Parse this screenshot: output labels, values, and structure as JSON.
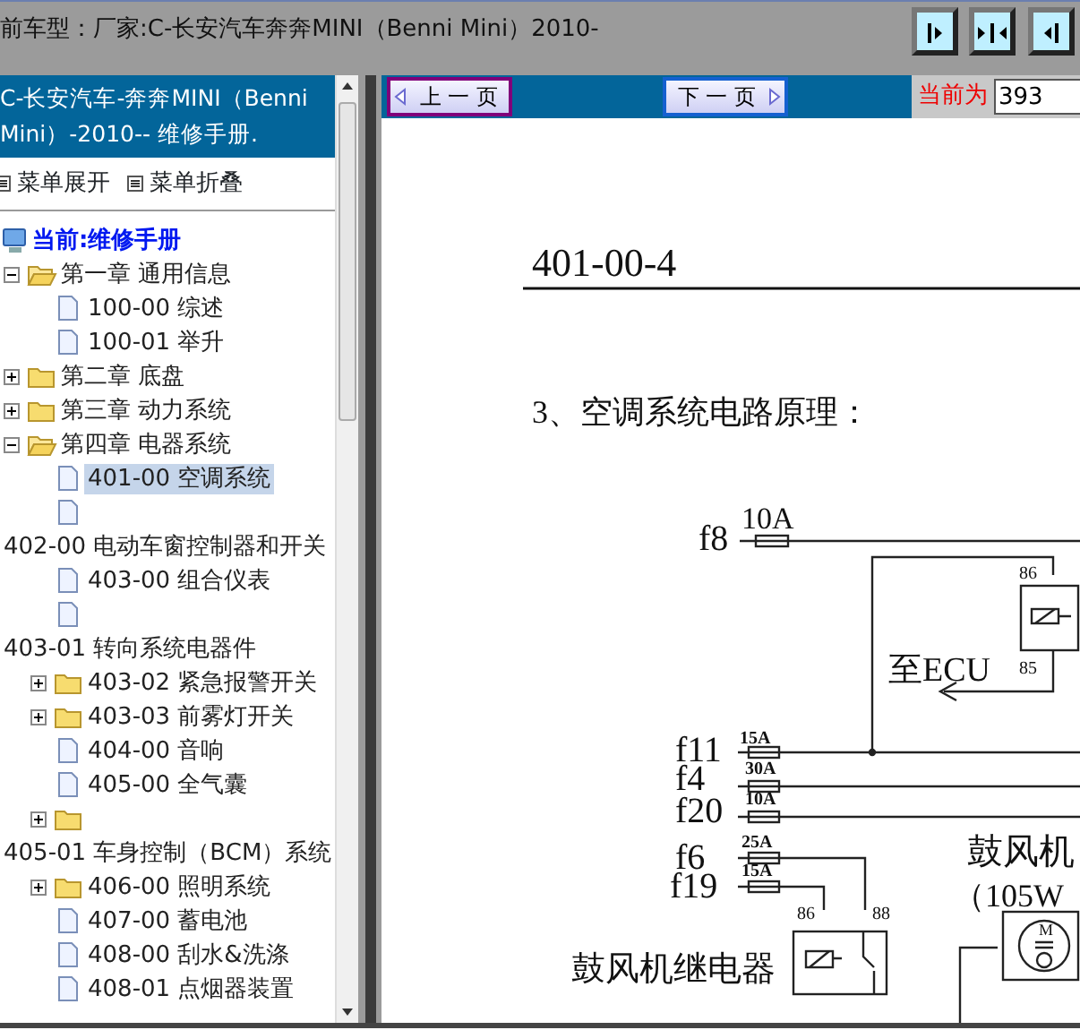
{
  "header": {
    "title": "前车型：厂家:C-长安汽车奔奔MINI（Benni Mini）2010-"
  },
  "sidebar": {
    "title": "C-长安汽车-奔奔MINI（Benni Mini）-2010-- 维修手册.",
    "menu_actions": [
      "菜单展开",
      "菜单折叠"
    ],
    "tree": [
      {
        "kind": "root",
        "label": "当前:维修手册",
        "selected": false,
        "children": [
          {
            "kind": "folder",
            "label": "第一章 通用信息",
            "expanded": true,
            "selected": false,
            "children": [
              {
                "kind": "doc",
                "label": "100-00 综述",
                "selected": false
              },
              {
                "kind": "doc",
                "label": "100-01 举升",
                "selected": false
              }
            ]
          },
          {
            "kind": "folder",
            "label": "第二章 底盘",
            "expanded": false,
            "selected": false
          },
          {
            "kind": "folder",
            "label": "第三章 动力系统",
            "expanded": false,
            "selected": false
          },
          {
            "kind": "folder",
            "label": "第四章 电器系统",
            "expanded": true,
            "selected": false,
            "children": [
              {
                "kind": "doc",
                "label": "401-00 空调系统",
                "selected": true
              },
              {
                "kind": "doc",
                "selected": false
              },
              {
                "kind": "plain",
                "label": "402-00 电动车窗控制器和开关",
                "selected": false
              },
              {
                "kind": "doc",
                "label": "403-00 组合仪表",
                "selected": false
              },
              {
                "kind": "doc",
                "selected": false
              },
              {
                "kind": "plain",
                "label": "403-01 转向系统电器件",
                "selected": false
              },
              {
                "kind": "folder",
                "label": "403-02 紧急报警开关",
                "expanded": false,
                "selected": false
              },
              {
                "kind": "folder",
                "label": "403-03 前雾灯开关",
                "expanded": false,
                "selected": false
              },
              {
                "kind": "doc",
                "label": "404-00 音响",
                "selected": false
              },
              {
                "kind": "doc",
                "label": "405-00 全气囊",
                "selected": false
              },
              {
                "kind": "folder",
                "expanded": false,
                "selected": false
              },
              {
                "kind": "plain",
                "label": "405-01 车身控制（BCM）系统",
                "selected": false
              },
              {
                "kind": "folder",
                "label": "406-00 照明系统",
                "expanded": false,
                "selected": false
              },
              {
                "kind": "doc",
                "label": "407-00 蓄电池",
                "selected": false
              },
              {
                "kind": "doc",
                "label": "408-00 刮水&洗涤",
                "selected": false
              },
              {
                "kind": "doc",
                "label": "408-01 点烟器装置",
                "selected": false
              }
            ]
          }
        ]
      }
    ]
  },
  "toolbar": {
    "prev_label": "上 一 页",
    "next_label": "下 一 页",
    "page_label": "当前为",
    "page_value": "393"
  },
  "document": {
    "page_number": "401-00-4",
    "heading": "3、空调系统电路原理：",
    "diagram_labels": [
      "f8",
      "10A",
      "86",
      "85",
      "至ECU",
      "f11",
      "15A",
      "f4",
      "30A",
      "f20",
      "10A",
      "f6",
      "25A",
      "f19",
      "15A",
      "鼓风机",
      "（105W",
      "86",
      "88",
      "鼓风机继电器",
      "M"
    ]
  }
}
